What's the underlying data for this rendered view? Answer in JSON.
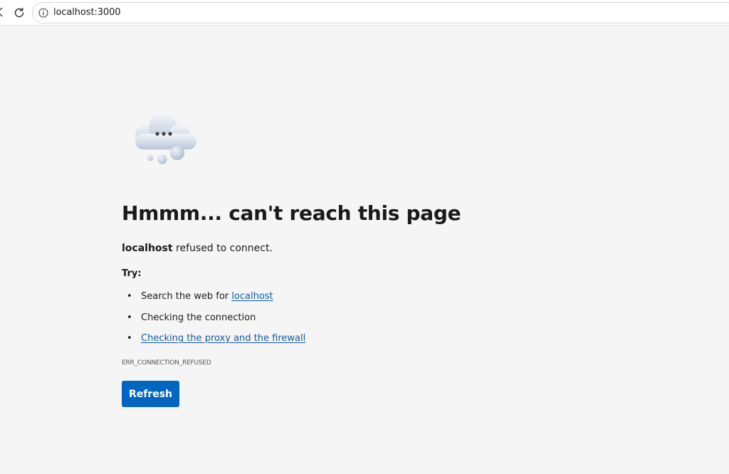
{
  "browser": {
    "url": "localhost:3000"
  },
  "error": {
    "title": "Hmmm... can't reach this page",
    "host": "localhost",
    "message_suffix": " refused to connect.",
    "try_label": "Try:",
    "suggestions": [
      {
        "prefix": "Search the web for ",
        "link": "localhost"
      },
      {
        "text": "Checking the connection"
      },
      {
        "link": "Checking the proxy and the firewall"
      }
    ],
    "code": "ERR_CONNECTION_REFUSED",
    "button_label": "Refresh"
  },
  "colors": {
    "background": "#f5f5f5",
    "link": "#0f5aa8",
    "button": "#0067c0"
  },
  "icons": [
    "back-arrow-icon",
    "refresh-icon",
    "info-icon",
    "cloud-error-icon"
  ]
}
